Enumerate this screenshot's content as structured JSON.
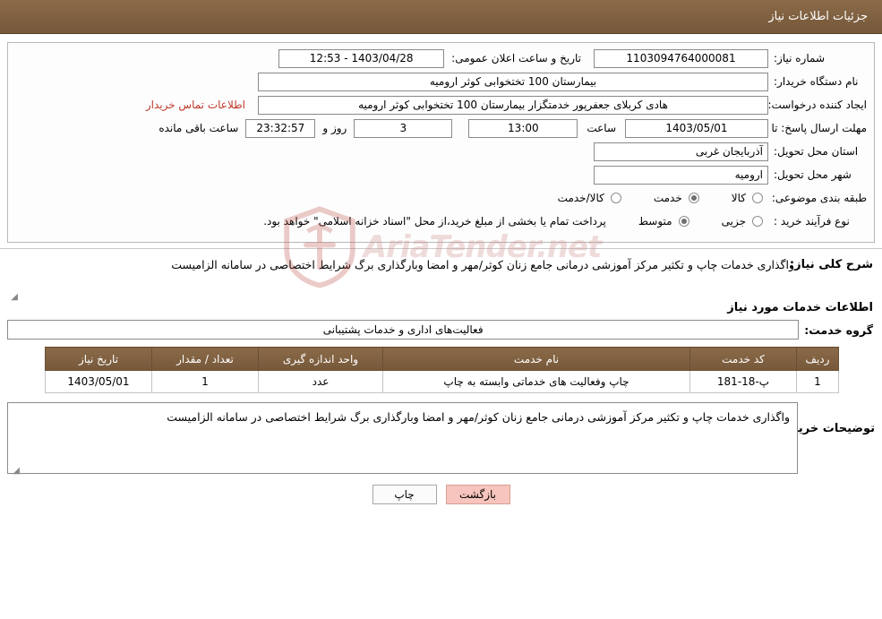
{
  "header": {
    "title": "جزئیات اطلاعات نیاز"
  },
  "form": {
    "need_number_label": "شماره نیاز:",
    "need_number_value": "1103094764000081",
    "announce_datetime_label": "تاریخ و ساعت اعلان عمومی:",
    "announce_datetime_value": "1403/04/28 - 12:53",
    "buyer_org_label": "نام دستگاه خریدار:",
    "buyer_org_value": "بیمارستان 100 تختخوابی کوثر ارومیه",
    "creator_label": "ایجاد کننده درخواست:",
    "creator_value": "هادی کربلای جعفرپور خدمتگزار بیمارستان 100 تختخوابی کوثر ارومیه",
    "contact_link": "اطلاعات تماس خریدار",
    "deadline_label": "مهلت ارسال پاسخ: تا تاریخ:",
    "deadline_date": "1403/05/01",
    "hour_label": "ساعت",
    "deadline_hour": "13:00",
    "days_value": "3",
    "days_label": "روز و",
    "remaining_time": "23:32:57",
    "remaining_label": "ساعت باقی مانده",
    "province_label": "استان محل تحویل:",
    "province_value": "آذربایجان غربی",
    "city_label": "شهر محل تحویل:",
    "city_value": "ارومیه",
    "category_label": "طبقه بندی موضوعی:",
    "category_options": [
      {
        "label": "کالا",
        "selected": false
      },
      {
        "label": "خدمت",
        "selected": true
      },
      {
        "label": "کالا/خدمت",
        "selected": false
      }
    ],
    "purchase_type_label": "نوع فرآیند خرید :",
    "purchase_type_options": [
      {
        "label": "جزیی",
        "selected": false
      },
      {
        "label": "متوسط",
        "selected": true
      }
    ],
    "purchase_note": "پرداخت تمام یا بخشی از مبلغ خرید،از محل \"اسناد خزانه اسلامی\" خواهد بود."
  },
  "description": {
    "label": "شرح کلی نیاز:",
    "text": "واگذاری خدمات چاپ و تکثیر مرکز آموزشی درمانی جامع زنان کوثر/مهر و امضا وبارگذاری برگ شرایط اختصاصی در سامانه الزامیست"
  },
  "services_section": {
    "title": "اطلاعات خدمات مورد نیاز",
    "group_label": "گروه خدمت:",
    "group_value": "فعالیت‌های اداری و خدمات پشتیبانی"
  },
  "table": {
    "headers": [
      "ردیف",
      "کد خدمت",
      "نام خدمت",
      "واحد اندازه گیری",
      "تعداد / مقدار",
      "تاریخ نیاز"
    ],
    "rows": [
      {
        "row": "1",
        "code": "پ-18-181",
        "name": "چاپ وفعالیت های خدماتی وابسته به چاپ",
        "unit": "عدد",
        "qty": "1",
        "date": "1403/05/01"
      }
    ]
  },
  "buyer_notes": {
    "label": "توضیحات خریدار:",
    "text": "واگذاری خدمات چاپ و تکثیر مرکز آموزشی درمانی جامع زنان کوثر/مهر و امضا وبارگذاری برگ شرایط اختصاصی در سامانه الزامیست"
  },
  "buttons": {
    "print": "چاپ",
    "back": "بازگشت"
  },
  "watermark": {
    "text": "AriaTender.net"
  },
  "colors": {
    "header_bg": "#7a5c3e",
    "link": "#c0392b",
    "back_button": "#f7c5bd"
  }
}
